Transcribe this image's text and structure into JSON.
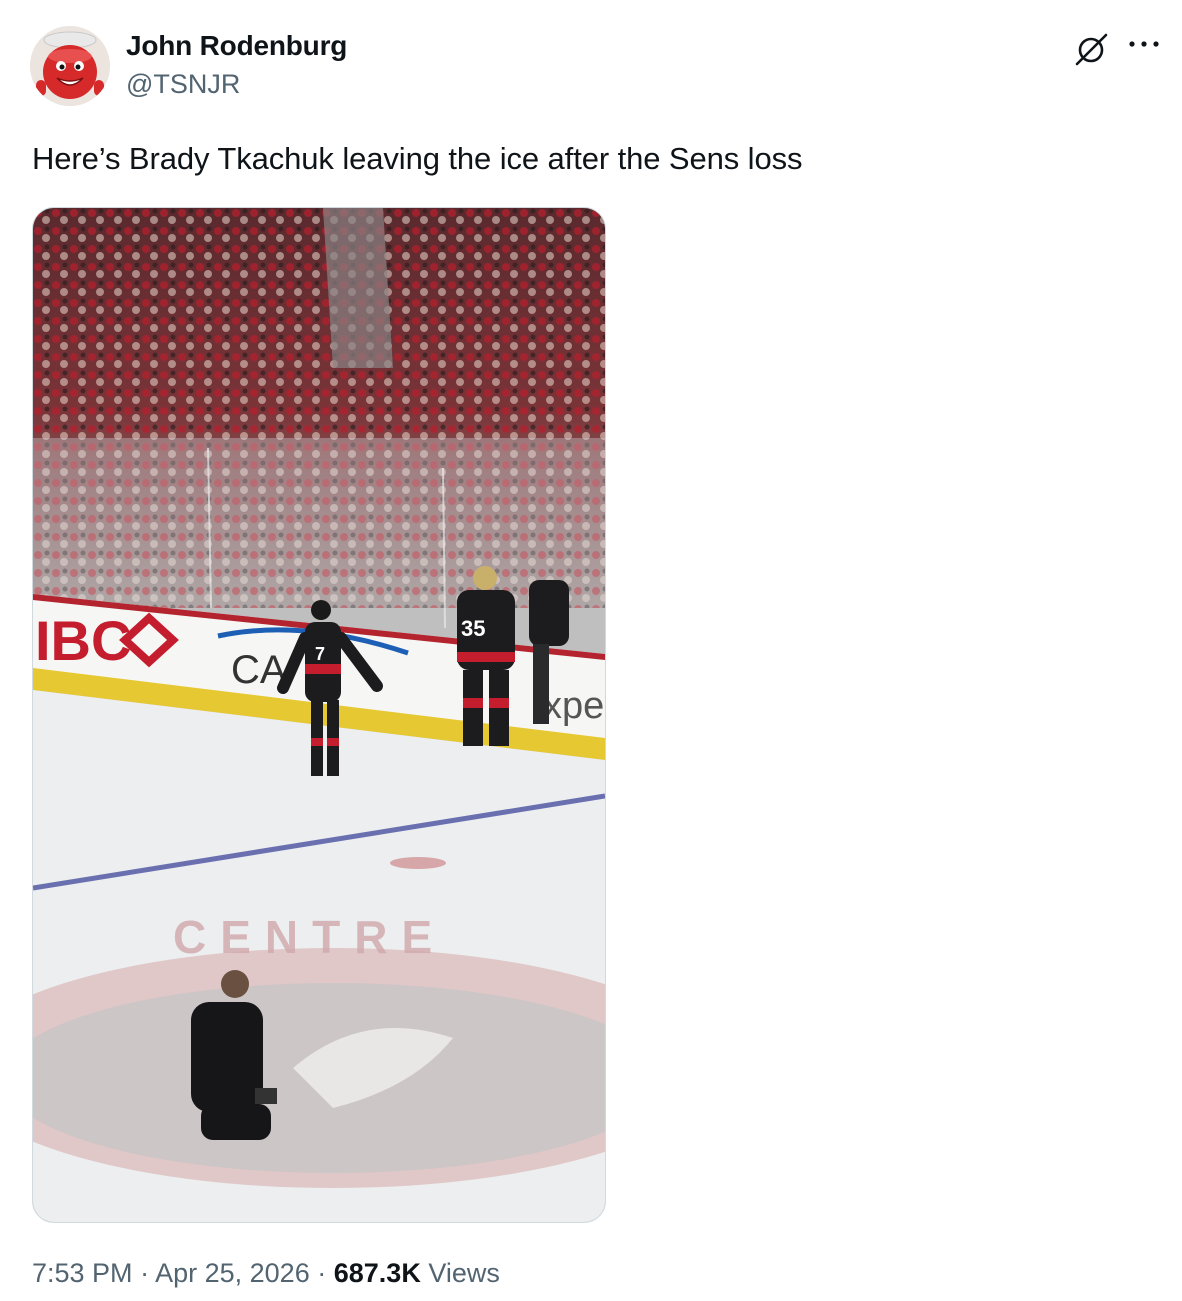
{
  "author": {
    "display_name": "John Rodenburg",
    "handle": "@TSNJR",
    "avatar_icon": "kool-aid-man-avatar"
  },
  "header_actions": {
    "grok_icon": "grok-icon",
    "more_icon": "more-horizontal-icon"
  },
  "tweet": {
    "text": "Here’s Brady Tkachuk leaving the ice after the Sens loss"
  },
  "media": {
    "type": "video-frame",
    "board_text_left": "IBC",
    "board_text_center": "CA",
    "board_text_right": "xpe",
    "jersey_number_player": "7",
    "jersey_number_goalie": "35",
    "center_ice_text": "CENTRE"
  },
  "meta": {
    "time": "7:53 PM",
    "separator": "·",
    "date": "Apr 25, 2026",
    "views_count": "687.3K",
    "views_label": "Views"
  },
  "colors": {
    "text_primary": "#0f1419",
    "text_secondary": "#536471",
    "border": "#cfd9de"
  }
}
